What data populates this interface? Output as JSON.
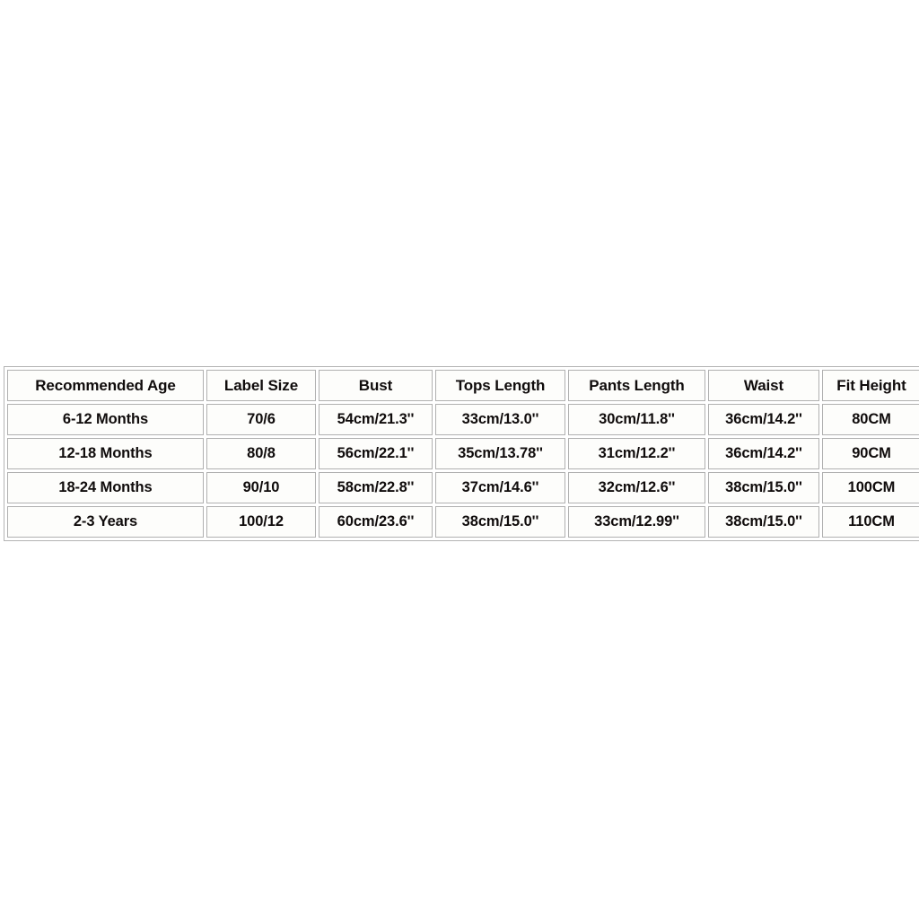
{
  "page": {
    "background_color": "#ffffff",
    "text_color": "#100c0c",
    "border_color": "#b0b0b0",
    "cell_background": "#fdfdfb"
  },
  "size_table": {
    "headers": [
      "Recommended Age",
      "Label Size",
      "Bust",
      "Tops Length",
      "Pants Length",
      "Waist",
      "Fit Height"
    ],
    "rows": [
      {
        "recommended_age": "6-12 Months",
        "label_size": "70/6",
        "bust": "54cm/21.3''",
        "tops_length": "33cm/13.0''",
        "pants_length": "30cm/11.8''",
        "waist": "36cm/14.2''",
        "fit_height": "80CM"
      },
      {
        "recommended_age": "12-18 Months",
        "label_size": "80/8",
        "bust": "56cm/22.1''",
        "tops_length": "35cm/13.78''",
        "pants_length": "31cm/12.2''",
        "waist": "36cm/14.2''",
        "fit_height": "90CM"
      },
      {
        "recommended_age": "18-24 Months",
        "label_size": "90/10",
        "bust": "58cm/22.8''",
        "tops_length": "37cm/14.6''",
        "pants_length": "32cm/12.6''",
        "waist": "38cm/15.0''",
        "fit_height": "100CM"
      },
      {
        "recommended_age": "2-3 Years",
        "label_size": "100/12",
        "bust": "60cm/23.6''",
        "tops_length": "38cm/15.0''",
        "pants_length": "33cm/12.99''",
        "waist": "38cm/15.0''",
        "fit_height": "110CM"
      }
    ]
  }
}
